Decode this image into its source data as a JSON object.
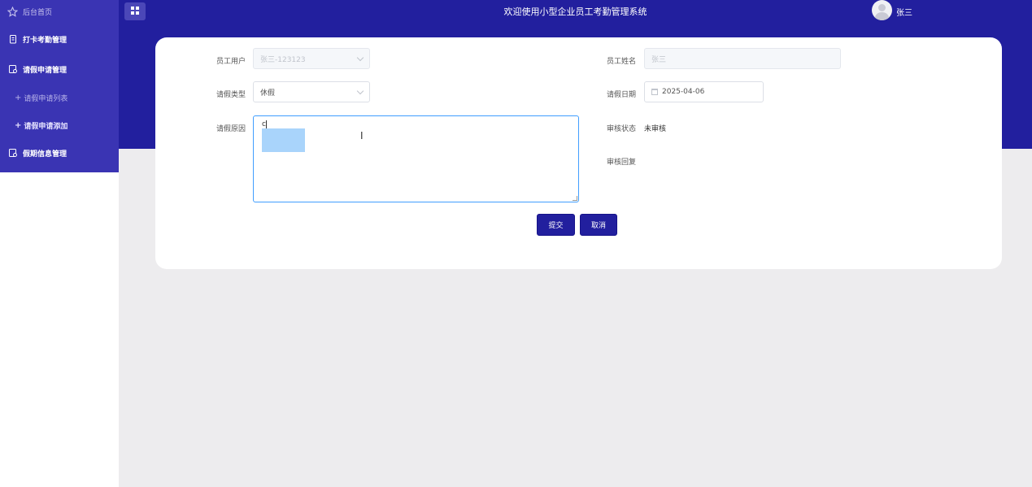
{
  "sidebar": {
    "home": "后台首页",
    "items": [
      {
        "label": "打卡考勤管理"
      },
      {
        "label": "请假申请管理"
      },
      {
        "label": "请假申请列表"
      },
      {
        "label": "请假申请添加"
      },
      {
        "label": "假期信息管理"
      }
    ]
  },
  "header": {
    "title": "欢迎使用小型企业员工考勤管理系统",
    "user_name": "张三"
  },
  "form": {
    "employee_user_label": "员工用户",
    "employee_user_value": "张三-123123",
    "employee_name_label": "员工姓名",
    "employee_name_value": "张三",
    "leave_type_label": "请假类型",
    "leave_type_value": "休假",
    "leave_date_label": "请假日期",
    "leave_date_value": "2025-04-06",
    "reason_label": "请假原因",
    "reason_value": "c",
    "review_status_label": "审核状态",
    "review_status_value": "未审核",
    "review_reply_label": "审核回复",
    "submit_label": "提交",
    "cancel_label": "取消"
  },
  "colors": {
    "header": "#221f9e",
    "sidebar_menu": "#3a34b3",
    "focus_border": "#409eff"
  }
}
